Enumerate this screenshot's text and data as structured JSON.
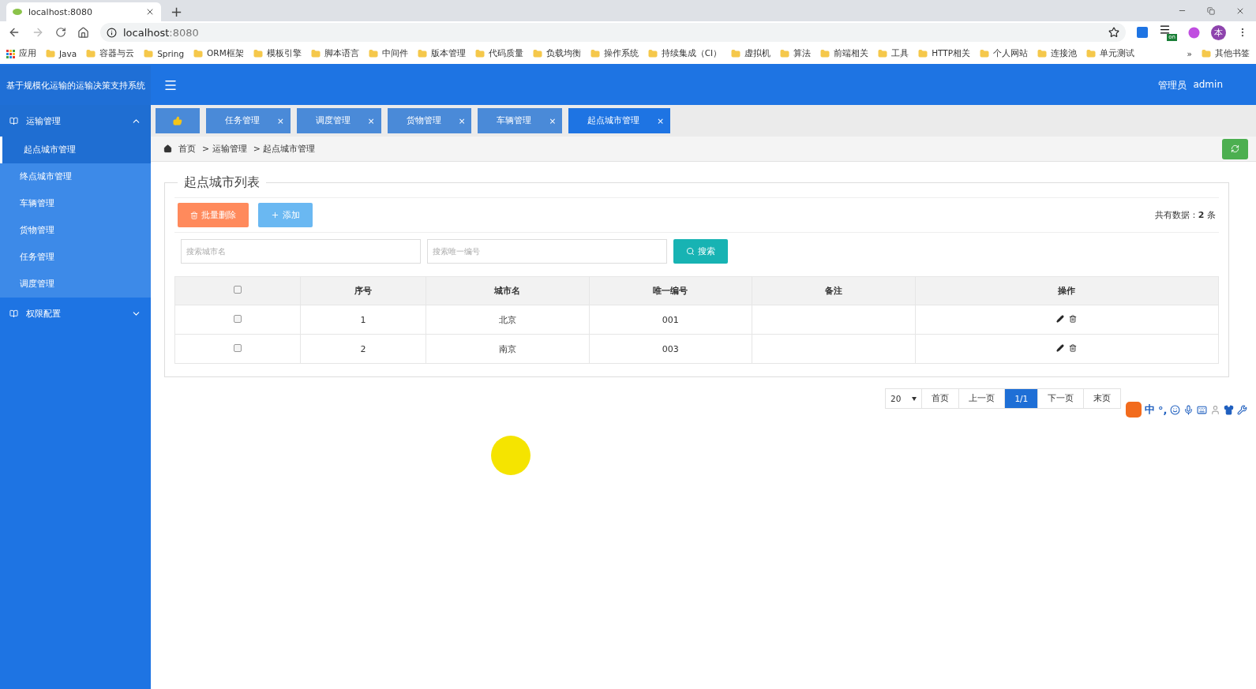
{
  "browser": {
    "tab_title": "localhost:8080",
    "new_tab": "+",
    "address_host": "localhost",
    "address_port": ":8080",
    "apps_label": "应用",
    "bookmarks": [
      "Java",
      "容器与云",
      "Spring",
      "ORM框架",
      "模板引擎",
      "脚本语言",
      "中间件",
      "版本管理",
      "代码质量",
      "负载均衡",
      "操作系统",
      "持续集成（CI）",
      "虚拟机",
      "算法",
      "前端相关",
      "工具",
      "HTTP相关",
      "个人网站",
      "连接池",
      "单元测试"
    ],
    "overflow": "»",
    "other_bookmarks": "其他书签",
    "extension_badge": "on",
    "profile": "本"
  },
  "app": {
    "title": "基于规模化运输的运输决策支持系统",
    "role": "管理员",
    "user": "admin"
  },
  "sidebar": [
    {
      "label": "运输管理",
      "expanded": true,
      "children": [
        {
          "label": "起点城市管理",
          "selected": true
        },
        {
          "label": "终点城市管理",
          "selected": false
        },
        {
          "label": "车辆管理",
          "selected": false
        },
        {
          "label": "货物管理",
          "selected": false
        },
        {
          "label": "任务管理",
          "selected": false
        },
        {
          "label": "调度管理",
          "selected": false
        }
      ]
    },
    {
      "label": "权限配置",
      "expanded": false
    }
  ],
  "tabs": [
    {
      "kind": "home",
      "selected": false
    },
    {
      "kind": "page",
      "label": "任务管理",
      "close": "×",
      "selected": false
    },
    {
      "kind": "page",
      "label": "调度管理",
      "close": "×",
      "selected": false
    },
    {
      "kind": "page",
      "label": "货物管理",
      "close": "×",
      "selected": false
    },
    {
      "kind": "page",
      "label": "车辆管理",
      "close": "×",
      "selected": false
    },
    {
      "kind": "page",
      "label": "起点城市管理",
      "close": "×",
      "selected": true
    }
  ],
  "breadcrumb": [
    "首页",
    "> 运输管理",
    "> 起点城市管理"
  ],
  "panel": {
    "title": "起点城市列表",
    "delete_button": "批量删除",
    "add_button": "添加",
    "count": "共有数据：**2** 条",
    "search_fields": [
      {
        "placeholder": "搜索城市名"
      },
      {
        "placeholder": "搜索唯一编号"
      }
    ],
    "search_button": "搜索"
  },
  "table": {
    "columns": [
      "序号",
      "城市名",
      "唯一编号",
      "备注",
      "操作"
    ],
    "all_checked": false,
    "rows": [
      {
        "checked": false,
        "cells": [
          "1",
          "北京",
          "001"
        ]
      },
      {
        "checked": false,
        "cells": [
          "2",
          "南京",
          "003"
        ]
      }
    ]
  },
  "pagination": {
    "page_size": "20",
    "pages": [
      {
        "label": "首页",
        "selected": false
      },
      {
        "label": "上一页",
        "selected": false
      },
      {
        "label": "1/1",
        "selected": true
      },
      {
        "label": "下一页",
        "selected": false
      },
      {
        "label": "末页",
        "selected": false
      }
    ]
  },
  "ime": {
    "mode": "中",
    "punct": "°,"
  }
}
